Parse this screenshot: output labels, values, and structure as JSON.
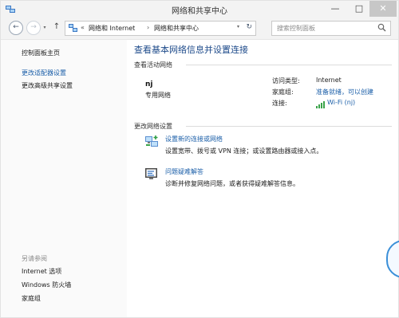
{
  "window": {
    "title": "网络和共享中心",
    "minimize": "—",
    "maximize": "□",
    "close": "✕"
  },
  "nav": {
    "back": "←",
    "forward": "→",
    "recent": "▾",
    "up": "↑"
  },
  "address": {
    "prefix": "«",
    "segments": [
      "网络和 Internet",
      "网络和共享中心"
    ],
    "separator": "›",
    "dropdown": "▾",
    "refresh": "↻"
  },
  "search": {
    "placeholder": "搜索控制面板"
  },
  "left_pane": {
    "links": [
      "控制面板主页",
      "更改适配器设置",
      "更改高级共享设置"
    ],
    "see_also_heading": "另请参阅",
    "see_also": [
      "Internet 选项",
      "Windows 防火墙",
      "家庭组"
    ]
  },
  "main": {
    "title": "查看基本网络信息并设置连接",
    "active_heading": "查看活动网络",
    "network": {
      "name": "nj",
      "type": "专用网络",
      "access_label": "访问类型:",
      "access_value": "Internet",
      "homegroup_label": "家庭组:",
      "homegroup_value": "准备就绪，可以创建",
      "connection_label": "连接:",
      "connection_value": "Wi-Fi (nj)"
    },
    "change_heading": "更改网络设置",
    "tasks": [
      {
        "link": "设置新的连接或网络",
        "desc": "设置宽带、拨号或 VPN 连接；或设置路由器或接入点。",
        "icon": "new-connection-icon"
      },
      {
        "link": "问题疑难解答",
        "desc": "诊断并修复网络问题，或者获得疑难解答信息。",
        "icon": "troubleshoot-icon"
      }
    ]
  },
  "colors": {
    "link": "#1a5ea8",
    "title": "#1d4a8a"
  }
}
